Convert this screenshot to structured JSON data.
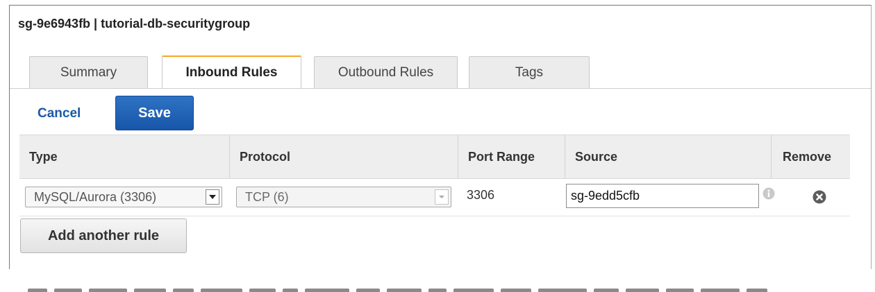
{
  "header": {
    "title": "sg-9e6943fb | tutorial-db-securitygroup"
  },
  "tabs": [
    {
      "label": "Summary",
      "active": false
    },
    {
      "label": "Inbound Rules",
      "active": true
    },
    {
      "label": "Outbound Rules",
      "active": false
    },
    {
      "label": "Tags",
      "active": false
    }
  ],
  "toolbar": {
    "cancel_label": "Cancel",
    "save_label": "Save"
  },
  "table": {
    "columns": [
      "Type",
      "Protocol",
      "Port Range",
      "Source",
      "Remove"
    ],
    "rows": [
      {
        "type": "MySQL/Aurora (3306)",
        "protocol": "TCP (6)",
        "port_range": "3306",
        "source": "sg-9edd5cfb",
        "remove_icon": "remove-circle-icon",
        "info_icon": "info-icon"
      }
    ]
  },
  "actions": {
    "add_rule_label": "Add another rule"
  },
  "colors": {
    "primary_button": "#1f62b4",
    "link": "#1a5aa6",
    "active_tab_accent": "#f5a623"
  }
}
